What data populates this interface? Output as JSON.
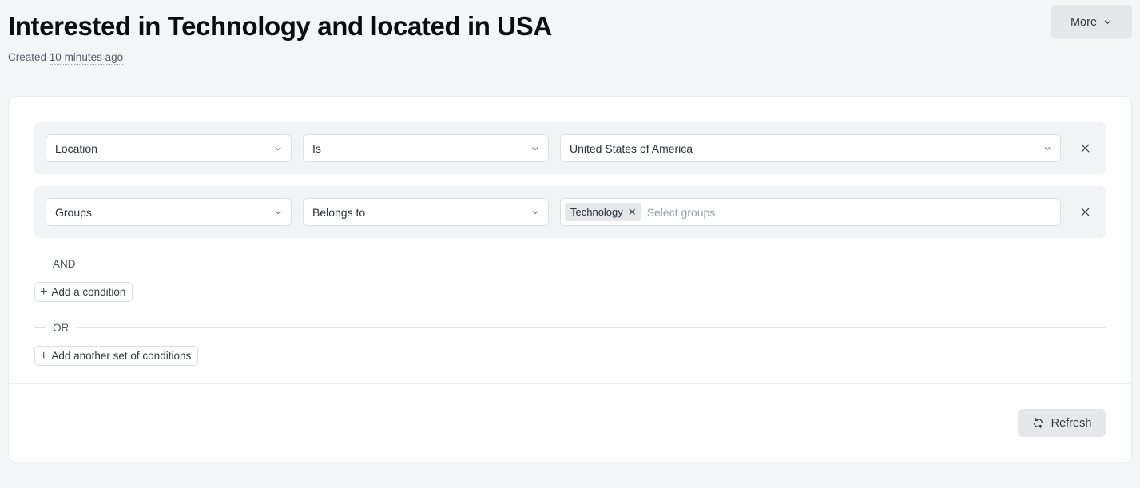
{
  "header": {
    "title": "Interested in Technology and located in USA",
    "created_prefix": "Created",
    "created_relative": "10 minutes ago",
    "more_label": "More",
    "more_icon": "chevron-down-icon"
  },
  "conditions": [
    {
      "subject": "Location",
      "operator": "Is",
      "value": "United States of America",
      "value_type": "select",
      "remove_icon": "close-icon"
    },
    {
      "subject": "Groups",
      "operator": "Belongs to",
      "value_type": "tags",
      "tags": [
        {
          "label": "Technology",
          "remove_icon": "close-icon"
        }
      ],
      "placeholder": "Select groups",
      "remove_icon": "close-icon"
    }
  ],
  "dividers": {
    "and_label": "AND",
    "or_label": "OR"
  },
  "actions": {
    "add_condition_label": "Add a condition",
    "add_condition_icon": "plus-icon",
    "add_group_label": "Add another set of conditions",
    "add_group_icon": "plus-icon",
    "refresh_label": "Refresh",
    "refresh_icon": "refresh-icon"
  },
  "colors": {
    "page_background": "#f4f5f7",
    "card_background": "#ffffff",
    "row_background": "#f1f3f5",
    "button_background": "#e6e7eb",
    "chip_background": "#e5e8eb",
    "text_primary": "#212529",
    "text_muted": "#545b63",
    "placeholder": "#9aa1a9",
    "border": "#dde1e5"
  }
}
